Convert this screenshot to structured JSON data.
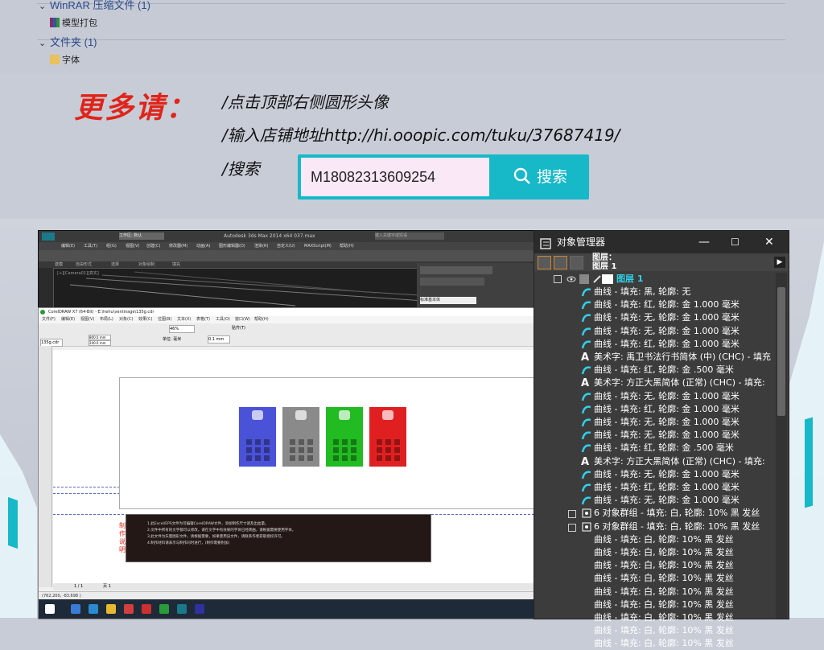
{
  "explorer": {
    "group1": {
      "label": "WinRAR 压缩文件 (1)",
      "file": "模型打包"
    },
    "group2": {
      "label": "文件夹 (1)",
      "file": "字体"
    }
  },
  "promo": {
    "heading": "更多请：",
    "line1": "/点击顶部右侧圆形头像",
    "line2": "/输入店铺地址http://hi.ooopic.com/tuku/37687419/",
    "line3": "/搜索",
    "search_value": "M18082313609254",
    "search_button": "搜索"
  },
  "max3ds": {
    "title": "Autodesk 3ds Max  2014 x64       037.max",
    "workspace": "工作区: 默认",
    "search_placeholder": "键入关键字或短语",
    "menu": [
      "编辑(E)",
      "工具(T)",
      "组(G)",
      "视图(V)",
      "创建(C)",
      "修改器(M)",
      "动画(A)",
      "图形编辑器(D)",
      "渲染(R)",
      "自定义(U)",
      "MAXScript(M)",
      "帮助(H)"
    ],
    "ribbon_tabs": [
      "建模",
      "自由形式",
      "选择",
      "对象绘制",
      "填充"
    ],
    "viewport_label": "[+][Camera01][真实]",
    "preset": "标准基本体"
  },
  "corel": {
    "title": "CorelDRAW X7 (64-Bit) - E:\\hehu\\ventinage\\135g.cdr",
    "menu": [
      "文件(F)",
      "编辑(E)",
      "视图(V)",
      "布局(L)",
      "对象(C)",
      "效果(C)",
      "位图(B)",
      "文本(X)",
      "表格(T)",
      "工具(O)",
      "窗口(W)",
      "帮助(H)"
    ],
    "zoom": "46%",
    "snap": "贴齐(T)",
    "units": "单位: 毫米",
    "nudge": "0.1 mm",
    "width": "800.0 mm",
    "height": "240.0 mm",
    "tab": "135g.cdr",
    "instructions_title": "制作说明",
    "instructions": [
      "1.此Excel/EPS文件为可编辑CorelDRAW文件，添加制作尺寸请及出血量。",
      "2.文件中所有的文字都可以修改，请在文字中有效果的字体已经转曲，请根据需要使用字体。",
      "3.此文件为矢量图形文件，请根据需要，如果使用该文件，请联系作者获取授权许可。",
      "4.制作材料请表示与制作同时进行，(制作需要附加)"
    ],
    "page_nav": "1 / 1",
    "page_name": "页 1",
    "status": "(762.200, -83.698 )"
  },
  "cards": [
    {
      "color": "#4a52d8"
    },
    {
      "color": "#8a8a8a"
    },
    {
      "color": "#22bb22"
    },
    {
      "color": "#e02020"
    }
  ],
  "object_manager": {
    "title": "对象管理器",
    "page_label": "图层：",
    "page_value": "图层 1",
    "layer": "图层 1",
    "rows": [
      "曲线 - 填充: 黑, 轮廓: 无",
      "曲线 - 填充: 红, 轮廓: 金  1.000 毫米",
      "曲线 - 填充: 无, 轮廓: 金  1.000 毫米",
      "曲线 - 填充: 无, 轮廓: 金  1.000 毫米",
      "曲线 - 填充: 红, 轮廓: 金  1.000 毫米",
      "美术字: 禹卫书法行书简体 (中) (CHC) - 填充",
      "曲线 - 填充: 红, 轮廓: 金  .500 毫米",
      "美术字: 方正大黑简体 (正常) (CHC) - 填充:",
      "曲线 - 填充: 无, 轮廓: 金  1.000 毫米",
      "曲线 - 填充: 红, 轮廓: 金  1.000 毫米",
      "曲线 - 填充: 无, 轮廓: 金  1.000 毫米",
      "曲线 - 填充: 无, 轮廓: 金  1.000 毫米",
      "曲线 - 填充: 红, 轮廓: 金  .500 毫米",
      "美术字: 方正大黑简体 (正常) (CHC) - 填充:",
      "曲线 - 填充: 无, 轮廓: 金  1.000 毫米",
      "曲线 - 填充: 红, 轮廓: 金  1.000 毫米",
      "曲线 - 填充: 无, 轮廓: 金  1.000 毫米",
      "6 对象群组 - 填充: 白, 轮廓: 10% 黑 发丝",
      "6 对象群组 - 填充: 白, 轮廓: 10% 黑 发丝",
      "曲线 - 填充: 白, 轮廓: 10% 黑 发丝",
      "曲线 - 填充: 白, 轮廓: 10% 黑 发丝",
      "曲线 - 填充: 白, 轮廓: 10% 黑 发丝",
      "曲线 - 填充: 白, 轮廓: 10% 黑 发丝",
      "曲线 - 填充: 白, 轮廓: 10% 黑 发丝",
      "曲线 - 填充: 白, 轮廓: 10% 黑 发丝",
      "曲线 - 填充: 白, 轮廓: 10% 黑 发丝",
      "曲线 - 填充: 白, 轮廓: 10% 黑 发丝",
      "曲线 - 填充: 白, 轮廓: 10% 黑 发丝"
    ],
    "row_types": [
      "curve",
      "curve",
      "curve",
      "curve",
      "curve",
      "text",
      "curve",
      "text",
      "curve",
      "curve",
      "curve",
      "curve",
      "curve",
      "text",
      "curve",
      "curve",
      "curve",
      "group",
      "group",
      "plain",
      "plain",
      "plain",
      "plain",
      "plain",
      "plain",
      "plain",
      "plain",
      "plain"
    ]
  },
  "colors": {
    "accent": "#17b8c8",
    "promo_red": "#e0241a",
    "layer_cyan": "#2fd0e8"
  }
}
